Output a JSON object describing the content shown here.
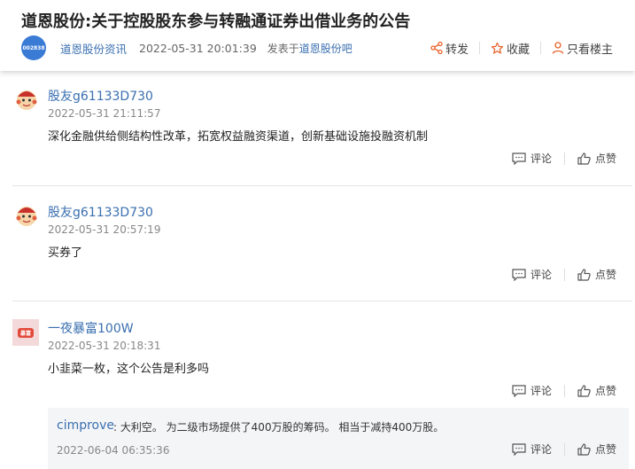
{
  "article": {
    "title": "道恩股份:关于控股股东参与转融通证券出借业务的公告",
    "logo_text": "002838",
    "source": "道恩股份资讯",
    "time": "2022-05-31 20:01:39",
    "posted_prefix": "发表于",
    "posted_bar": "道恩股份吧",
    "actions": {
      "share": "转发",
      "favorite": "收藏",
      "only_author": "只看楼主"
    }
  },
  "posts": [
    {
      "user": "股友g61133D730",
      "time": "2022-05-31 21:11:57",
      "content": "深化金融供给侧结构性改革，拓宽权益融资渠道，创新基础设施投融资机制",
      "comment": "评论",
      "like": "点赞"
    },
    {
      "user": "股友g61133D730",
      "time": "2022-05-31 20:57:19",
      "content": "买券了",
      "comment": "评论",
      "like": "点赞"
    },
    {
      "user": "一夜暴富100W",
      "time": "2022-05-31 20:18:31",
      "content": "小韭菜一枚，这个公告是利多吗",
      "comment": "评论",
      "like": "点赞",
      "avatar_text": "暴富"
    }
  ],
  "reply": {
    "user": "cimprove",
    "text": ": 大利空。 为二级市场提供了400万股的筹码。 相当于减持400万股。",
    "time": "2022-06-04 06:35:36",
    "comment": "评论",
    "like": "点赞"
  },
  "colors": {
    "link": "#3a6fb0",
    "logo": "#3a7bd5",
    "accent_icon": "#e8632b"
  }
}
